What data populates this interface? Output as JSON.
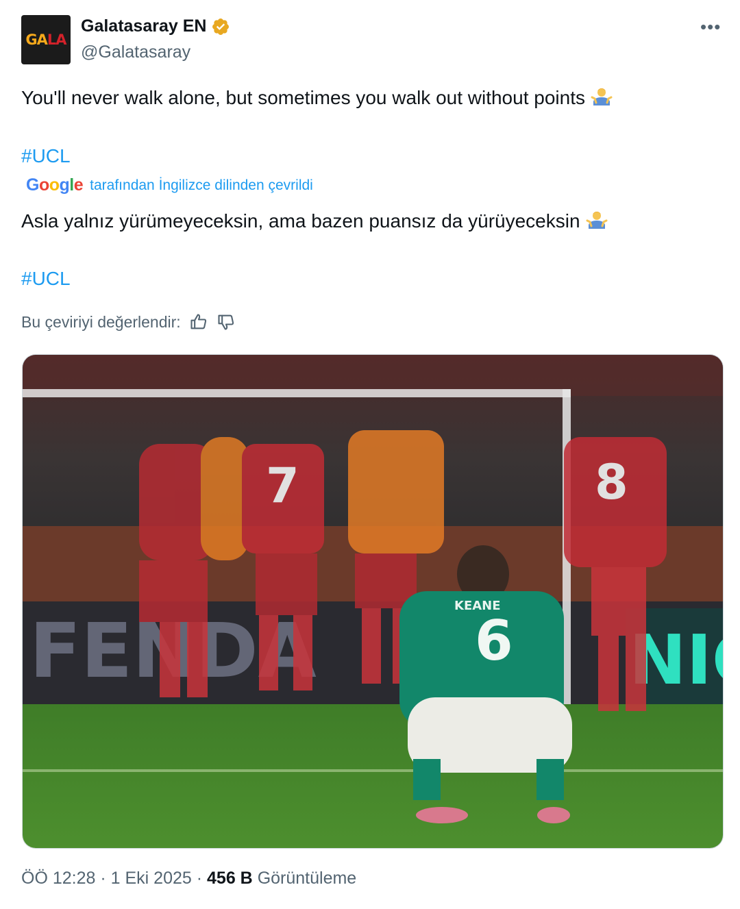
{
  "account": {
    "display_name": "Galatasaray EN",
    "handle": "@Galatasaray",
    "avatar_text": "GALA",
    "verified_badge_icon": "verified-badge-gold"
  },
  "tweet": {
    "text": "You'll never walk alone, but sometimes you walk out without points",
    "hashtag": "#UCL",
    "emoji_icon": "man-shrugging"
  },
  "translation": {
    "provider_logo": "Google",
    "label": "tarafından İngilizce dilinden çevrildi",
    "text": "Asla yalnız yürümeyeceksin, ama bazen puansız da yürüyeceksin",
    "hashtag": "#UCL",
    "rate_label": "Bu çeviriyi değerlendir:",
    "thumbs_up_icon": "thumbs-up",
    "thumbs_down_icon": "thumbs-down"
  },
  "media": {
    "description_icon": "photo",
    "jersey_number_front": "7",
    "jersey_number_right": "8",
    "jersey_number_player": "6",
    "jersey_name_player": "KEANE",
    "board_text_left": "FENDA",
    "board_text_right": "NIG"
  },
  "footer": {
    "time": "ÖÖ 12:28",
    "separator": "·",
    "date": "1 Eki 2025",
    "views_count": "456 B",
    "views_label": "Görüntüleme"
  },
  "colors": {
    "link": "#1d9bf0",
    "secondary_text": "#536471",
    "primary_text": "#0f1419",
    "verified_gold": "#e8a821"
  }
}
